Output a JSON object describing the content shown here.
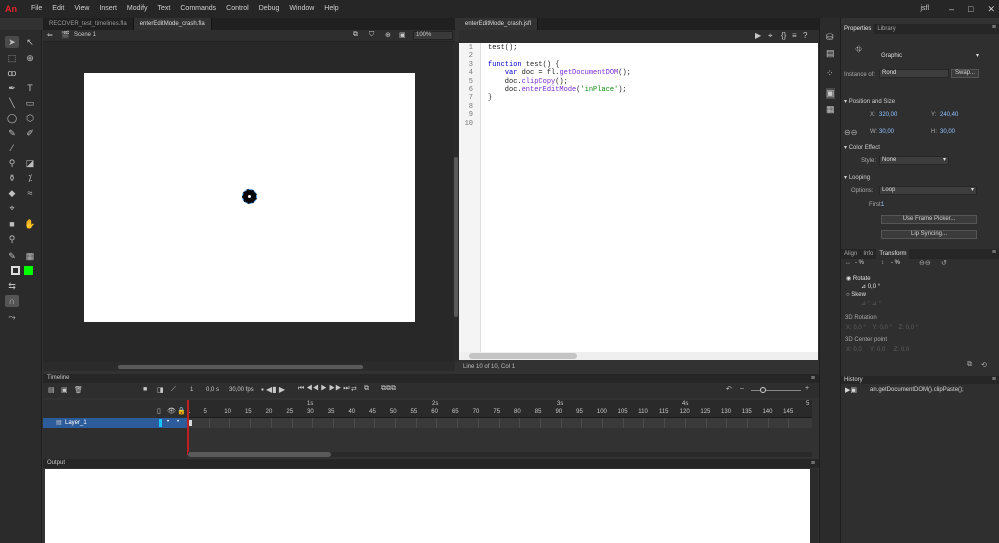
{
  "app": {
    "logo": "An",
    "user": "jsfl"
  },
  "menu": [
    "File",
    "Edit",
    "View",
    "Insert",
    "Modify",
    "Text",
    "Commands",
    "Control",
    "Debug",
    "Window",
    "Help"
  ],
  "doc_tabs": [
    "RECOVER_test_timelines.fla",
    "enterEditMode_crash.fla"
  ],
  "code_tab": "enterEditMode_crash.jsfl",
  "scene": {
    "name": "Scene 1",
    "zoom": "100%"
  },
  "code_lines": [
    {
      "n": "1",
      "text": "test();"
    },
    {
      "n": "2",
      "text": ""
    },
    {
      "n": "3",
      "text": "function test() {"
    },
    {
      "n": "4",
      "text": "    var doc = fl.getDocumentDOM();"
    },
    {
      "n": "5",
      "text": "    doc.clipCopy();"
    },
    {
      "n": "6",
      "text": "    doc.enterEditMode('inPlace');"
    },
    {
      "n": "7",
      "text": "}"
    },
    {
      "n": "8",
      "text": ""
    },
    {
      "n": "9",
      "text": ""
    },
    {
      "n": "10",
      "text": ""
    }
  ],
  "code_status": "Line 10 of 10, Col 1",
  "timeline": {
    "title": "Timeline",
    "frame_label": "1",
    "time": "0,0 s",
    "fps": "30,00 fps",
    "seconds": [
      "1s",
      "2s",
      "3s",
      "4s",
      "5"
    ],
    "frame_numbers": [
      "1",
      "5",
      "10",
      "15",
      "20",
      "25",
      "30",
      "35",
      "40",
      "45",
      "50",
      "55",
      "60",
      "65",
      "70",
      "75",
      "80",
      "85",
      "90",
      "95",
      "100",
      "105",
      "110",
      "115",
      "120",
      "125",
      "130",
      "135",
      "140",
      "145"
    ],
    "layer": "Layer_1",
    "playhead_frame": 1
  },
  "output": {
    "title": "Output"
  },
  "properties": {
    "tabs": [
      "Properties",
      "Library"
    ],
    "symbol_type": "Graphic",
    "instance_of_label": "Instance of:",
    "instance_of": "Rond",
    "swap": "Swap...",
    "pos_size": "Position and Size",
    "x_label": "X:",
    "x": "320,00",
    "y_label": "Y:",
    "y": "240,40",
    "w_label": "W:",
    "w": "30,00",
    "h_label": "H:",
    "h": "30,00",
    "color_effect": "Color Effect",
    "style_label": "Style:",
    "style": "None",
    "looping": "Looping",
    "options_label": "Options:",
    "options": "Loop",
    "first_label": "First:",
    "first": "1",
    "use_frame_picker": "Use Frame Picker...",
    "lip_syncing": "Lip Syncing..."
  },
  "transform": {
    "tabs": [
      "Align",
      "Info",
      "Transform"
    ],
    "w_pct": "- %",
    "h_pct": "- %",
    "rotate": "Rotate",
    "rotate_val": "0,0 °",
    "skew": "Skew",
    "rot3d": "3D Rotation",
    "center3d": "3D Center point",
    "x3": "X:",
    "y3": "Y:",
    "z3": "Z:",
    "zero": "0,0 °",
    "zeroc": "0,0"
  },
  "history": {
    "title": "History",
    "item": "an.getDocumentDOM().clipPaste();"
  },
  "colors": {
    "stroke": "#000000",
    "fill": "#00ff00",
    "accent": "#2d5c9b",
    "playhead": "#c01f1f"
  }
}
